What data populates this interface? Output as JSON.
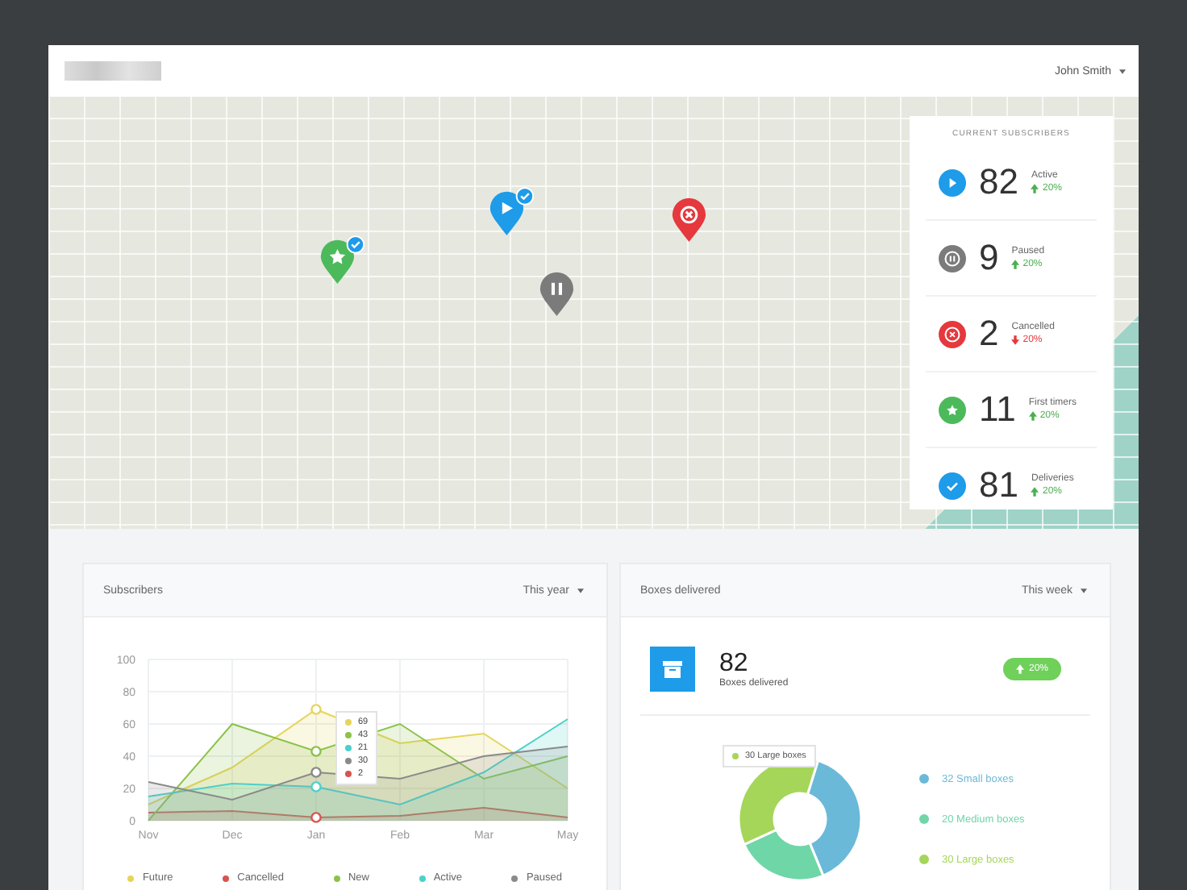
{
  "header": {
    "user": "John Smith"
  },
  "map": {
    "pins": [
      {
        "kind": "star",
        "color": "#4cba5a",
        "verified": true
      },
      {
        "kind": "play",
        "color": "#1e9be9",
        "verified": true
      },
      {
        "kind": "pause",
        "color": "#7b7b7b",
        "verified": false
      },
      {
        "kind": "cancel",
        "color": "#e5393d",
        "verified": false
      }
    ]
  },
  "subscribers_card": {
    "title": "CURRENT SUBSCRIBERS",
    "items": [
      {
        "kind": "play",
        "color": "#1e9be9",
        "count": "82",
        "label": "Active",
        "falling": false,
        "change": "20%"
      },
      {
        "kind": "pause",
        "color": "#7b7b7b",
        "count": "9",
        "label": "Paused",
        "falling": false,
        "change": "20%"
      },
      {
        "kind": "cancel",
        "color": "#e5393d",
        "count": "2",
        "label": "Cancelled",
        "falling": true,
        "change": "20%"
      },
      {
        "kind": "star",
        "color": "#4cba5a",
        "count": "11",
        "label": "First timers",
        "falling": false,
        "change": "20%"
      },
      {
        "kind": "check",
        "color": "#1e9be9",
        "count": "81",
        "label": "Deliveries",
        "falling": false,
        "change": "20%"
      }
    ]
  },
  "subscribers_panel": {
    "title": "Subscribers",
    "period": "This year",
    "chart_data": {
      "type": "area",
      "categories": [
        "Nov",
        "Dec",
        "Jan",
        "Feb",
        "Mar",
        "May"
      ],
      "ylim": [
        0,
        100
      ],
      "yticks": [
        0,
        20,
        40,
        60,
        80,
        100
      ],
      "grid": true,
      "legend": "bottom",
      "series": [
        {
          "name": "Future",
          "color": "#e6d55c",
          "values": [
            10,
            33,
            69,
            48,
            54,
            20
          ]
        },
        {
          "name": "Cancelled",
          "color": "#d9534f",
          "values": [
            5,
            6,
            2,
            3,
            8,
            2
          ]
        },
        {
          "name": "New",
          "color": "#8bc34a",
          "values": [
            0,
            60,
            43,
            60,
            26,
            40
          ]
        },
        {
          "name": "Active",
          "color": "#4dd0c8",
          "values": [
            15,
            23,
            21,
            10,
            30,
            63
          ]
        },
        {
          "name": "Paused",
          "color": "#8a8a8a",
          "values": [
            24,
            13,
            30,
            26,
            40,
            46
          ]
        }
      ]
    },
    "tooltip": {
      "items": [
        {
          "value": "69",
          "color": "#e6d55c"
        },
        {
          "value": "43",
          "color": "#8bc34a"
        },
        {
          "value": "21",
          "color": "#4dd0c8"
        },
        {
          "value": "30",
          "color": "#8a8a8a"
        },
        {
          "value": "2",
          "color": "#d9534f"
        }
      ]
    }
  },
  "boxes_panel": {
    "title": "Boxes delivered",
    "period": "This week",
    "total": "82",
    "total_label": "Boxes delivered",
    "falling": false,
    "change": "20%",
    "chart_data": {
      "type": "donut",
      "categories": [
        "32 Small boxes",
        "20 Medium boxes",
        "30 Large boxes"
      ],
      "values": [
        32,
        20,
        30
      ]
    },
    "tooltip": "30 Large boxes"
  }
}
